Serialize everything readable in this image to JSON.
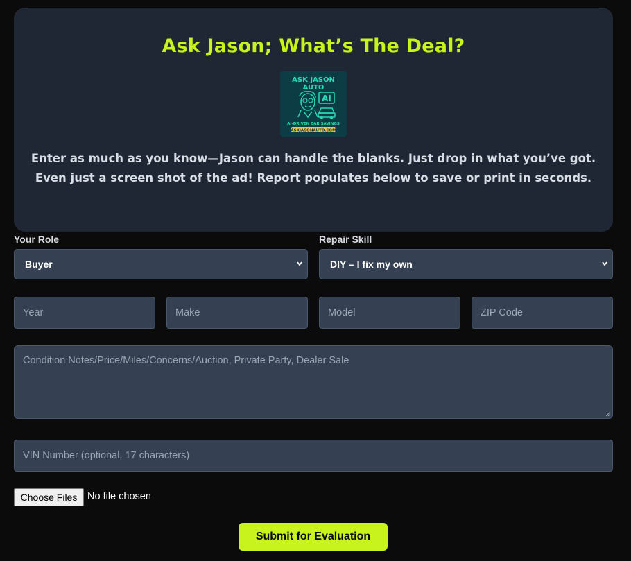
{
  "hero": {
    "title": "Ask Jason; What’s The Deal?",
    "description_line1": "Enter as much as you know—Jason can handle the blanks. Just drop in what you’ve got.",
    "description_line2": "Even just a screen shot of the ad! Report populates below to save or print in seconds.",
    "logo": {
      "line1": "ASK JASON",
      "line2": "AUTO",
      "badge": "AI",
      "tagline": "AI-DRIVEN CAR SAVINGS",
      "url": "ASKJASONAUTO.COM"
    }
  },
  "form": {
    "role": {
      "label": "Your Role",
      "value": "Buyer"
    },
    "skill": {
      "label": "Repair Skill",
      "value": "DIY – I fix my own"
    },
    "year_placeholder": "Year",
    "make_placeholder": "Make",
    "model_placeholder": "Model",
    "zip_placeholder": "ZIP Code",
    "notes_placeholder": "Condition Notes/Price/Miles/Concerns/Auction, Private Party, Dealer Sale",
    "vin_placeholder": "VIN Number (optional, 17 characters)",
    "file_button": "Choose Files",
    "file_status": "No file chosen",
    "submit_label": "Submit for Evaluation"
  },
  "colors": {
    "accent": "#c9f31d",
    "card": "#1f2735",
    "input_bg": "#354153",
    "page_bg": "#0b0b0b"
  }
}
